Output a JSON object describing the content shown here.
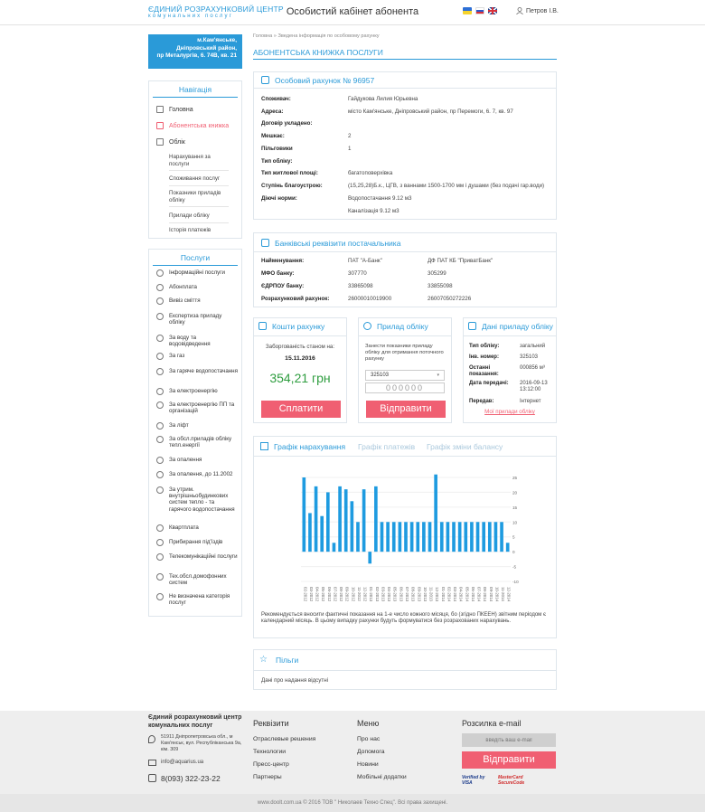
{
  "header": {
    "logo_line1": "ЄДИНИЙ РОЗРАХУНКОВИЙ ЦЕНТР",
    "logo_line2": "комунальних послуг",
    "title": "Особистий кабінет абонента",
    "user": "Петров І.В."
  },
  "address": [
    "м.Кам'янське,",
    "Дніпровський район,",
    "пр Металургів, 6. 74В, кв. 21"
  ],
  "nav": {
    "title": "Навігація",
    "items": [
      {
        "label": "Головна"
      },
      {
        "label": "Абонентська книжка",
        "active": true
      },
      {
        "label": "Облік"
      }
    ],
    "subitems": [
      "Нарахування за послуги",
      "Споживання послуг",
      "Показники приладів обліку",
      "Прилади обліку",
      "Історія платежів"
    ]
  },
  "services": {
    "title": "Послуги",
    "items": [
      "Інформаційні послуги",
      "Абонплата",
      "Вивіз сміття",
      "Експертиза приладу обліку",
      "За воду та водовідведення",
      "За газ",
      "За гаряче водопостачання",
      "За електроенергію",
      "За електроенергію ПП та організацій",
      "За ліфт",
      "За обсл.приладів обліку тепл.енергії",
      "За опалення",
      "За опалення, до 11.2002",
      "За утрим. внутрішньобудинкових систем тепло - та гарячого водопостачання",
      "Квартплата",
      "Прибирання під'їздів",
      "Телекомунікаційні послуги",
      "Тех.обсл.домофонних систем",
      "Не визначена категорія послуг"
    ]
  },
  "breadcrumb": "Головна » Зведена інформація по особовому рахунку",
  "page_title": "АБОНЕНТСЬКА КНИЖКА ПОСЛУГИ",
  "account": {
    "title": "Особовий рахунок № 96957",
    "rows": [
      {
        "label": "Споживач:",
        "value": "Гайдукова Лилия Юрьевна"
      },
      {
        "label": "Адреса:",
        "value": "місто Кам'янське, Дніпровський район, пр Перемоги, 6. 7, кв. 97"
      },
      {
        "label": "Договір укладено:",
        "value": ""
      },
      {
        "label": "Мешкає:",
        "value": "2"
      },
      {
        "label": "Пільговики",
        "value": "1"
      },
      {
        "label": "Тип обліку:",
        "value": ""
      },
      {
        "label": "Тип житлової площі:",
        "value": "багатоповерхівка"
      },
      {
        "label": "Ступінь благоустрою:",
        "value": "(15,25,28)Б.к., ЦГВ, з ваннами 1500-1700 мм і душами (без подачі гар.води)"
      },
      {
        "label": "Діючі норми:",
        "value": "Водопостачання 9.12 м3"
      },
      {
        "label": "",
        "value": "Каналізація 9.12 м3"
      }
    ]
  },
  "bank": {
    "title": "Банківські реквізити постачальника",
    "rows": [
      {
        "label": "Найменування:",
        "a": "ПАТ \"А-Банк\"",
        "b": "ДФ ПАТ КБ \"ПриватБанк\""
      },
      {
        "label": "МФО банку:",
        "a": "307770",
        "b": "305299"
      },
      {
        "label": "ЄДРПОУ банку:",
        "a": "33865098",
        "b": "33855098"
      },
      {
        "label": "Розрахунковий рахунок:",
        "a": "26000010019900",
        "b": "26007050272226"
      }
    ]
  },
  "funds": {
    "title": "Кошти рахунку",
    "debt_label": "Заборгованість станом на:",
    "date": "15.11.2016",
    "amount": "354,21 грн",
    "pay_button": "Сплатити"
  },
  "meter": {
    "title": "Прилад обліку",
    "hint": "Занести показники приладу обліку для отримання поточного рахунку",
    "selected": "325103",
    "reading": "000000",
    "send_button": "Відправити"
  },
  "meter_data": {
    "title": "Дані приладу обліку",
    "rows": [
      {
        "label": "Тип обліку:",
        "value": "загальний"
      },
      {
        "label": "Інв. номер:",
        "value": "325103"
      },
      {
        "label": "Останні показання:",
        "value": "000856 м³"
      },
      {
        "label": "Дата передачі:",
        "value": "2016-09-13 13:12:00"
      },
      {
        "label": "Передав:",
        "value": "Інтернет"
      }
    ],
    "link": "Мої прилади обліку"
  },
  "chart_tabs": [
    "Графік нарахування",
    "Графік платежів",
    "Графік зміни балансу"
  ],
  "chart_note": "Рекомендується вносити фактичні показання на 1-е число кожного місяця, бо (згідно ПКЕЕН) звітним періодом є календарний місяць. В цьому випадку рахунки будуть формуватися без розрахованих нарахувань.",
  "chart_data": {
    "type": "bar",
    "ylim": [
      -10,
      25
    ],
    "yticks": [
      25,
      20,
      15,
      10,
      5,
      0,
      -5,
      -10
    ],
    "categories": [
      "02-2012",
      "03-2012",
      "04-2012",
      "05-2012",
      "06-2012",
      "07-2012",
      "08-2012",
      "09-2012",
      "10-2012",
      "11-2012",
      "12-2012",
      "01-2013",
      "02-2013",
      "03-2013",
      "04-2013",
      "05-2013",
      "06-2013",
      "07-2013",
      "08-2013",
      "09-2013",
      "10-2013",
      "11-2013",
      "12-2013",
      "01-2014",
      "02-2014",
      "03-2014",
      "04-2014",
      "05-2014",
      "06-2014",
      "07-2014",
      "08-2014",
      "09-2014",
      "10-2014",
      "11-2014",
      "12-2014"
    ],
    "values": [
      25,
      13,
      22,
      12,
      20,
      3,
      22,
      21,
      17,
      10,
      21,
      -4,
      22,
      10,
      10,
      10,
      10,
      10,
      10,
      10,
      10,
      10,
      26,
      10,
      10,
      10,
      10,
      10,
      10,
      10,
      10,
      10,
      10,
      10,
      3
    ]
  },
  "benefits": {
    "title": "Пільги",
    "text": "Дані про надання відсутні"
  },
  "footer": {
    "org": "Єдиний розрахунковий центр комунальних послуг",
    "address": "51911 Дніпропетровська обл., м Кам'янськ, вул. Республіканська 9а, кім. 309",
    "email": "info@aquarius.ua",
    "phone": "8(093) 322-23-22",
    "cols": [
      {
        "title": "Реквізити",
        "links": [
          "Отраслевые решения",
          "Технологии",
          "Пресс-центр",
          "Партнеры"
        ]
      },
      {
        "title": "Меню",
        "links": [
          "Про нас",
          "Допомога",
          "Новини",
          "Мобільні додатки"
        ]
      }
    ],
    "subscribe": {
      "title": "Розсилка e-mail",
      "placeholder": "введіть ваш e-mail",
      "button": "Відправити"
    },
    "badges": [
      "Verified by VISA",
      "MasterCard SecureCode"
    ],
    "copyright": "www.doolt.com.ua © 2016 ТОВ \" Николаев Техно Спец\". Всі права захищені."
  },
  "colors": {
    "accent": "#2a9ad8",
    "button": "#f05f72",
    "amount": "#2e9d3f",
    "bar": "#1e9be0"
  }
}
